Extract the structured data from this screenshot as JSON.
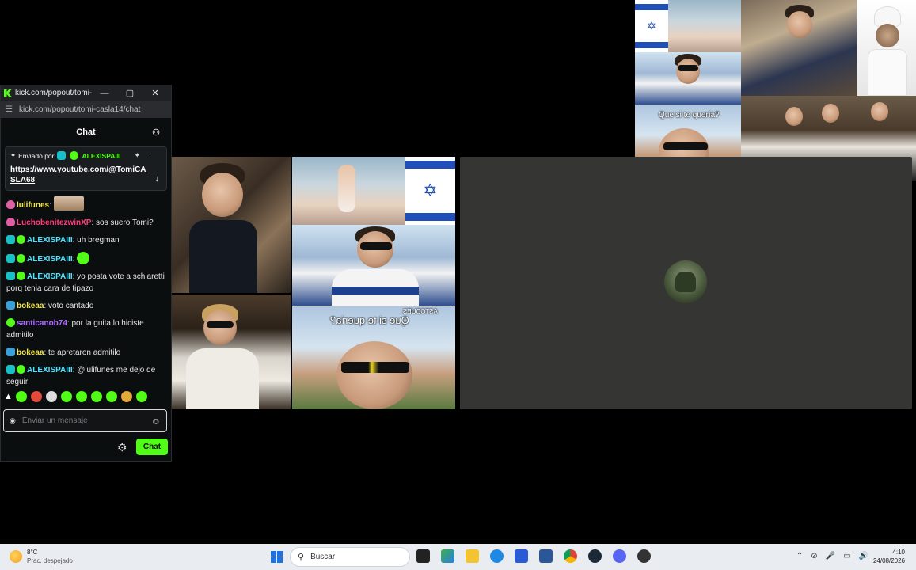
{
  "chat_window": {
    "tab_title": "kick.com/popout/tomi-casla...",
    "url": "kick.com/popout/tomi-casla14/chat",
    "window_controls": {
      "minimize": "—",
      "maximize": "▢",
      "close": "✕"
    },
    "header_title": "Chat",
    "pinned": {
      "label": "Enviado por",
      "username": "ALEXISPAIII",
      "link": "https://www.youtube.com/@TomiCASLA68"
    },
    "messages": [
      {
        "user": "lulifunes",
        "text": "",
        "color": "u-yellow",
        "badges": [
          "heart"
        ],
        "emote": "image"
      },
      {
        "user": "LuchobenitezwinXP",
        "text": "sos suero Tomi?",
        "color": "u-pink",
        "badges": [
          "heart"
        ],
        "emote": ""
      },
      {
        "user": "ALEXISPAIII",
        "text": "uh bregman",
        "color": "u-cyan",
        "badges": [
          "sub",
          "ver"
        ],
        "emote": ""
      },
      {
        "user": "ALEXISPAIII",
        "text": "",
        "color": "u-cyan",
        "badges": [
          "sub",
          "ver"
        ],
        "emote": "round"
      },
      {
        "user": "ALEXISPAIII",
        "text": "yo posta vote a schiaretti porq tenia cara de tipazo",
        "color": "u-cyan",
        "badges": [
          "sub",
          "ver"
        ],
        "emote": ""
      },
      {
        "user": "bokeaa",
        "text": "voto cantado",
        "color": "u-yellow",
        "badges": [
          "boost"
        ],
        "emote": ""
      },
      {
        "user": "santicanob74",
        "text": "por la guita lo hiciste admitilo",
        "color": "u-purple",
        "badges": [
          "ver"
        ],
        "emote": ""
      },
      {
        "user": "bokeaa",
        "text": "te apretaron admitilo",
        "color": "u-yellow",
        "badges": [
          "boost"
        ],
        "emote": ""
      },
      {
        "user": "ALEXISPAIII",
        "text": "@lulifunes me dejo de seguir",
        "color": "u-cyan",
        "badges": [
          "sub",
          "ver"
        ],
        "emote": ""
      }
    ],
    "input_placeholder": "Enviar un mensaje",
    "send_label": "Chat"
  },
  "video_overlays": {
    "caption_top_right": "Que si te quería?",
    "caption_center_mirrored": "Que si te quería?",
    "tag": "ASTODUES"
  },
  "taskbar": {
    "weather_temp": "8°C",
    "weather_desc": "Prac. despejado",
    "search_placeholder": "Buscar",
    "time": "4:10",
    "date": "24/08/2026"
  },
  "colors": {
    "kick_green": "#53fc18",
    "chat_bg": "#0b0e0f",
    "panel_grey": "#353634",
    "taskbar_bg": "#e9ecf1"
  }
}
